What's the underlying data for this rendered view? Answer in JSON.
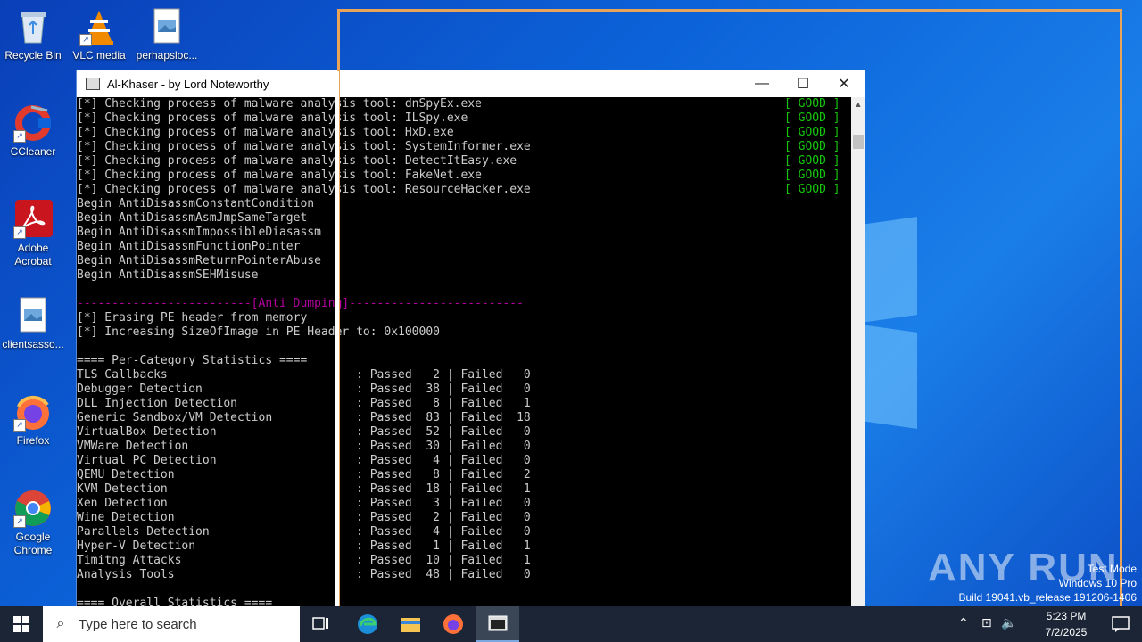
{
  "desktop": {
    "icons": [
      {
        "label": "Recycle Bin",
        "icon": "recycle-bin-icon"
      },
      {
        "label": "VLC media",
        "icon": "vlc-icon"
      },
      {
        "label": "perhapsloc...",
        "icon": "image-file-icon"
      },
      {
        "label": "CCleaner",
        "icon": "ccleaner-icon"
      },
      {
        "label": "Adobe Acrobat",
        "icon": "acrobat-icon"
      },
      {
        "label": "clientsasso...",
        "icon": "image-file-icon"
      },
      {
        "label": "Firefox",
        "icon": "firefox-icon"
      },
      {
        "label": "Google Chrome",
        "icon": "chrome-icon"
      }
    ]
  },
  "window": {
    "title": "Al-Khaser - by Lord Noteworthy",
    "minimize": "—",
    "maximize": "☐",
    "close": "✕"
  },
  "console": {
    "good_label": "[ GOOD ]",
    "process_lines": [
      "[*] Checking process of malware analysis tool: dnSpyEx.exe",
      "[*] Checking process of malware analysis tool: ILSpy.exe",
      "[*] Checking process of malware analysis tool: HxD.exe",
      "[*] Checking process of malware analysis tool: SystemInformer.exe",
      "[*] Checking process of malware analysis tool: DetectItEasy.exe",
      "[*] Checking process of malware analysis tool: FakeNet.exe",
      "[*] Checking process of malware analysis tool: ResourceHacker.exe"
    ],
    "begin_lines": [
      "Begin AntiDisassmConstantCondition",
      "Begin AntiDisassmAsmJmpSameTarget",
      "Begin AntiDisassmImpossibleDiasassm",
      "Begin AntiDisassmFunctionPointer",
      "Begin AntiDisassmReturnPointerAbuse",
      "Begin AntiDisassmSEHMisuse"
    ],
    "anti_dumping_header": "-------------------------[Anti Dumping]-------------------------",
    "dump_lines": [
      "[*] Erasing PE header from memory",
      "[*] Increasing SizeOfImage in PE Header to: 0x100000"
    ],
    "stats_header": "==== Per-Category Statistics ====",
    "stats": [
      {
        "name": "TLS Callbacks",
        "passed": "2",
        "failed": "0"
      },
      {
        "name": "Debugger Detection",
        "passed": "38",
        "failed": "0"
      },
      {
        "name": "DLL Injection Detection",
        "passed": "8",
        "failed": "1"
      },
      {
        "name": "Generic Sandbox/VM Detection",
        "passed": "83",
        "failed": "18"
      },
      {
        "name": "VirtualBox Detection",
        "passed": "52",
        "failed": "0"
      },
      {
        "name": "VMWare Detection",
        "passed": "30",
        "failed": "0"
      },
      {
        "name": "Virtual PC Detection",
        "passed": "4",
        "failed": "0"
      },
      {
        "name": "QEMU Detection",
        "passed": "8",
        "failed": "2"
      },
      {
        "name": "KVM Detection",
        "passed": "18",
        "failed": "1"
      },
      {
        "name": "Xen Detection",
        "passed": "3",
        "failed": "0"
      },
      {
        "name": "Wine Detection",
        "passed": "2",
        "failed": "0"
      },
      {
        "name": "Parallels Detection",
        "passed": "4",
        "failed": "0"
      },
      {
        "name": "Hyper-V Detection",
        "passed": "1",
        "failed": "1"
      },
      {
        "name": "Timitng Attacks",
        "passed": "10",
        "failed": "1"
      },
      {
        "name": "Analysis Tools",
        "passed": "48",
        "failed": "0"
      }
    ],
    "passed_label": "Passed",
    "failed_label": "Failed",
    "overall_header": "==== Overall Statistics ===="
  },
  "taskbar": {
    "search_placeholder": "Type here to search",
    "time": "5:23 PM",
    "date": "7/2/2025"
  },
  "watermark": {
    "brand": "ANY RUN",
    "test_mode": "Test Mode",
    "edition": "Windows 10 Pro",
    "build": "Build 19041.vb_release.191206-1406"
  },
  "colors": {
    "good": "#16c60c",
    "magenta": "#b4009e",
    "frame": "#e9a45a"
  }
}
